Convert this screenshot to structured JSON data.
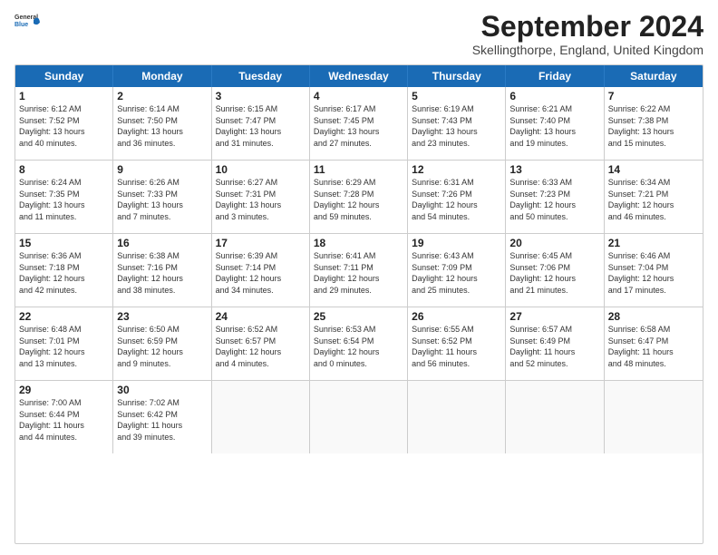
{
  "header": {
    "logo_general": "General",
    "logo_blue": "Blue",
    "month_title": "September 2024",
    "location": "Skellingthorpe, England, United Kingdom"
  },
  "days_of_week": [
    "Sunday",
    "Monday",
    "Tuesday",
    "Wednesday",
    "Thursday",
    "Friday",
    "Saturday"
  ],
  "rows": [
    [
      {
        "day": "",
        "empty": true,
        "text": ""
      },
      {
        "day": "2",
        "empty": false,
        "text": "Sunrise: 6:14 AM\nSunset: 7:50 PM\nDaylight: 13 hours\nand 36 minutes."
      },
      {
        "day": "3",
        "empty": false,
        "text": "Sunrise: 6:15 AM\nSunset: 7:47 PM\nDaylight: 13 hours\nand 31 minutes."
      },
      {
        "day": "4",
        "empty": false,
        "text": "Sunrise: 6:17 AM\nSunset: 7:45 PM\nDaylight: 13 hours\nand 27 minutes."
      },
      {
        "day": "5",
        "empty": false,
        "text": "Sunrise: 6:19 AM\nSunset: 7:43 PM\nDaylight: 13 hours\nand 23 minutes."
      },
      {
        "day": "6",
        "empty": false,
        "text": "Sunrise: 6:21 AM\nSunset: 7:40 PM\nDaylight: 13 hours\nand 19 minutes."
      },
      {
        "day": "7",
        "empty": false,
        "text": "Sunrise: 6:22 AM\nSunset: 7:38 PM\nDaylight: 13 hours\nand 15 minutes."
      }
    ],
    [
      {
        "day": "1",
        "empty": false,
        "text": "Sunrise: 6:12 AM\nSunset: 7:52 PM\nDaylight: 13 hours\nand 40 minutes.",
        "leader": true
      },
      {
        "day": "9",
        "empty": false,
        "text": "Sunrise: 6:26 AM\nSunset: 7:33 PM\nDaylight: 13 hours\nand 7 minutes."
      },
      {
        "day": "10",
        "empty": false,
        "text": "Sunrise: 6:27 AM\nSunset: 7:31 PM\nDaylight: 13 hours\nand 3 minutes."
      },
      {
        "day": "11",
        "empty": false,
        "text": "Sunrise: 6:29 AM\nSunset: 7:28 PM\nDaylight: 12 hours\nand 59 minutes."
      },
      {
        "day": "12",
        "empty": false,
        "text": "Sunrise: 6:31 AM\nSunset: 7:26 PM\nDaylight: 12 hours\nand 54 minutes."
      },
      {
        "day": "13",
        "empty": false,
        "text": "Sunrise: 6:33 AM\nSunset: 7:23 PM\nDaylight: 12 hours\nand 50 minutes."
      },
      {
        "day": "14",
        "empty": false,
        "text": "Sunrise: 6:34 AM\nSunset: 7:21 PM\nDaylight: 12 hours\nand 46 minutes."
      }
    ],
    [
      {
        "day": "8",
        "empty": false,
        "text": "Sunrise: 6:24 AM\nSunset: 7:35 PM\nDaylight: 13 hours\nand 11 minutes.",
        "leader": true
      },
      {
        "day": "16",
        "empty": false,
        "text": "Sunrise: 6:38 AM\nSunset: 7:16 PM\nDaylight: 12 hours\nand 38 minutes."
      },
      {
        "day": "17",
        "empty": false,
        "text": "Sunrise: 6:39 AM\nSunset: 7:14 PM\nDaylight: 12 hours\nand 34 minutes."
      },
      {
        "day": "18",
        "empty": false,
        "text": "Sunrise: 6:41 AM\nSunset: 7:11 PM\nDaylight: 12 hours\nand 29 minutes."
      },
      {
        "day": "19",
        "empty": false,
        "text": "Sunrise: 6:43 AM\nSunset: 7:09 PM\nDaylight: 12 hours\nand 25 minutes."
      },
      {
        "day": "20",
        "empty": false,
        "text": "Sunrise: 6:45 AM\nSunset: 7:06 PM\nDaylight: 12 hours\nand 21 minutes."
      },
      {
        "day": "21",
        "empty": false,
        "text": "Sunrise: 6:46 AM\nSunset: 7:04 PM\nDaylight: 12 hours\nand 17 minutes."
      }
    ],
    [
      {
        "day": "15",
        "empty": false,
        "text": "Sunrise: 6:36 AM\nSunset: 7:18 PM\nDaylight: 12 hours\nand 42 minutes.",
        "leader": true
      },
      {
        "day": "23",
        "empty": false,
        "text": "Sunrise: 6:50 AM\nSunset: 6:59 PM\nDaylight: 12 hours\nand 9 minutes."
      },
      {
        "day": "24",
        "empty": false,
        "text": "Sunrise: 6:52 AM\nSunset: 6:57 PM\nDaylight: 12 hours\nand 4 minutes."
      },
      {
        "day": "25",
        "empty": false,
        "text": "Sunrise: 6:53 AM\nSunset: 6:54 PM\nDaylight: 12 hours\nand 0 minutes."
      },
      {
        "day": "26",
        "empty": false,
        "text": "Sunrise: 6:55 AM\nSunset: 6:52 PM\nDaylight: 11 hours\nand 56 minutes."
      },
      {
        "day": "27",
        "empty": false,
        "text": "Sunrise: 6:57 AM\nSunset: 6:49 PM\nDaylight: 11 hours\nand 52 minutes."
      },
      {
        "day": "28",
        "empty": false,
        "text": "Sunrise: 6:58 AM\nSunset: 6:47 PM\nDaylight: 11 hours\nand 48 minutes."
      }
    ],
    [
      {
        "day": "22",
        "empty": false,
        "text": "Sunrise: 6:48 AM\nSunset: 7:01 PM\nDaylight: 12 hours\nand 13 minutes.",
        "leader": true
      },
      {
        "day": "30",
        "empty": false,
        "text": "Sunrise: 7:02 AM\nSunset: 6:42 PM\nDaylight: 11 hours\nand 39 minutes."
      },
      {
        "day": "",
        "empty": true,
        "text": ""
      },
      {
        "day": "",
        "empty": true,
        "text": ""
      },
      {
        "day": "",
        "empty": true,
        "text": ""
      },
      {
        "day": "",
        "empty": true,
        "text": ""
      },
      {
        "day": "",
        "empty": true,
        "text": ""
      }
    ],
    [
      {
        "day": "29",
        "empty": false,
        "text": "Sunrise: 7:00 AM\nSunset: 6:44 PM\nDaylight: 11 hours\nand 44 minutes.",
        "leader": true
      },
      {
        "day": "",
        "empty": true,
        "text": ""
      },
      {
        "day": "",
        "empty": true,
        "text": ""
      },
      {
        "day": "",
        "empty": true,
        "text": ""
      },
      {
        "day": "",
        "empty": true,
        "text": ""
      },
      {
        "day": "",
        "empty": true,
        "text": ""
      },
      {
        "day": "",
        "empty": true,
        "text": ""
      }
    ]
  ]
}
